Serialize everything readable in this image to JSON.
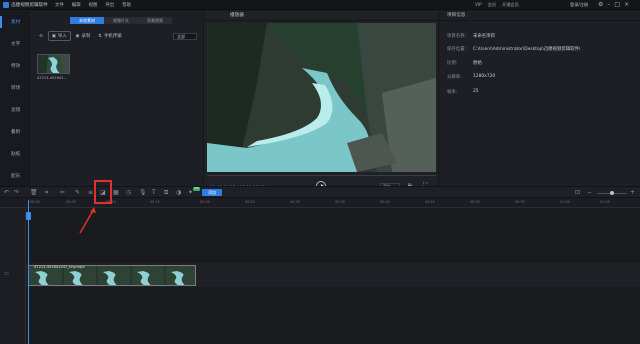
{
  "titlebar": {
    "app_title": "迅捷视频剪辑软件",
    "menu": [
      "文件",
      "编辑",
      "视图",
      "导出",
      "帮助"
    ],
    "right_info": [
      "VIP",
      "会员",
      "开通会员"
    ],
    "login": "登录/注册"
  },
  "leftnav": {
    "items": [
      {
        "label": "素材"
      },
      {
        "label": "文字"
      },
      {
        "label": "特效"
      },
      {
        "label": "转场"
      },
      {
        "label": "滤镜"
      },
      {
        "label": "叠附"
      },
      {
        "label": "贴纸"
      },
      {
        "label": "配乐"
      }
    ]
  },
  "media": {
    "tabs": [
      "本地素材",
      "视频片头",
      "背景视频"
    ],
    "import_label": "导入",
    "record_label": "录制",
    "mobile_label": "手机传输",
    "filter_value": "全部",
    "thumb_name": "47213-451641..."
  },
  "preview": {
    "title": "播放器",
    "current_time": "00:00:00.17",
    "total_time": "00:00:00.08",
    "ratio": "原始"
  },
  "info": {
    "title": "项目信息",
    "rows": [
      {
        "k": "项目名称:",
        "v": "未命名项目"
      },
      {
        "k": "保存位置:",
        "v": "C:\\Users\\Administrator\\Desktop\\迅捷视频剪辑软件\\"
      },
      {
        "k": "比例:",
        "v": "原始"
      },
      {
        "k": "分辨率:",
        "v": "1280x720"
      },
      {
        "k": "帧率:",
        "v": "25"
      }
    ]
  },
  "timeline": {
    "add_label": "添加",
    "vip_badge": "VIP",
    "ruler_ticks": [
      "00:00",
      "00:05",
      "00:10",
      "00:15",
      "00:20",
      "00:25",
      "00:30",
      "00:35",
      "00:40",
      "00:45",
      "00:50",
      "00:55",
      "01:00",
      "01:05",
      "01:10"
    ],
    "clip_label": "47213-451641047_tiny.mp4"
  },
  "colors": {
    "accent": "#3d8ef0",
    "highlight": "#e0322a",
    "background": "#1c1d22"
  }
}
